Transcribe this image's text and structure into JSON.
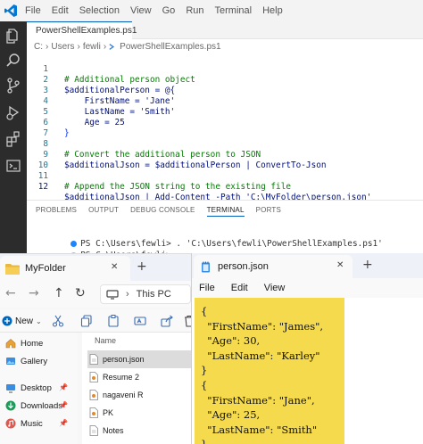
{
  "vscode": {
    "menu": [
      "File",
      "Edit",
      "Selection",
      "View",
      "Go",
      "Run",
      "Terminal",
      "Help"
    ],
    "tab_label": "PowerShellExamples.ps1",
    "breadcrumb": [
      "C:",
      "Users",
      "fewli",
      "PowerShellExamples.ps1"
    ],
    "code_lines": [
      {
        "num": "1",
        "text": "# Additional person object"
      },
      {
        "num": "2",
        "text": "$additionalPerson = @{"
      },
      {
        "num": "3",
        "text": "    FirstName = 'Jane'"
      },
      {
        "num": "4",
        "text": "    LastName = 'Smith'"
      },
      {
        "num": "5",
        "text": "    Age = 25"
      },
      {
        "num": "6",
        "text": "}"
      },
      {
        "num": "7",
        "text": ""
      },
      {
        "num": "8",
        "text": "# Convert the additional person to JSON"
      },
      {
        "num": "9",
        "text": "$additionalJson = $additionalPerson | ConvertTo-Json"
      },
      {
        "num": "10",
        "text": ""
      },
      {
        "num": "11",
        "text": "# Append the JSON string to the existing file"
      },
      {
        "num": "12",
        "text": "$additionalJson | Add-Content -Path 'C:\\MyFolder\\person.json'"
      }
    ],
    "panel_tabs": [
      "PROBLEMS",
      "OUTPUT",
      "DEBUG CONSOLE",
      "TERMINAL",
      "PORTS"
    ],
    "active_panel_tab": "TERMINAL",
    "terminal_lines": [
      "PS C:\\Users\\fewli> . 'C:\\Users\\fewli\\PowerShellExamples.ps1'",
      "PS C:\\Users\\fewli> "
    ]
  },
  "explorer": {
    "tab_title": "MyFolder",
    "address": "This PC",
    "new_label": "New",
    "nav_items": [
      {
        "label": "Home",
        "icon": "home-icon"
      },
      {
        "label": "Gallery",
        "icon": "gallery-icon"
      },
      {
        "label": "Desktop",
        "icon": "desktop-icon"
      },
      {
        "label": "Downloads",
        "icon": "downloads-icon"
      },
      {
        "label": "Music",
        "icon": "music-icon"
      }
    ],
    "column_header": "Name",
    "files": [
      {
        "name": "person.json",
        "icon": "document-icon",
        "selected": true
      },
      {
        "name": "Resume 2",
        "icon": "document-icon",
        "selected": false
      },
      {
        "name": "nagaveni R",
        "icon": "document-icon",
        "selected": false
      },
      {
        "name": "PK",
        "icon": "document-icon",
        "selected": false
      },
      {
        "name": "Notes",
        "icon": "document-icon",
        "selected": false
      }
    ]
  },
  "notepad": {
    "tab_title": "person.json",
    "menu": [
      "File",
      "Edit",
      "View"
    ],
    "highlight_color": "#f4da4c",
    "lines": [
      "{",
      "  \"FirstName\": \"James\",",
      "  \"Age\": 30,",
      "  \"LastName\": \"Karley\"",
      "}",
      "{",
      "  \"FirstName\": \"Jane\",",
      "  \"Age\": 25,",
      "  \"LastName\": \"Smith\"",
      "}"
    ]
  }
}
